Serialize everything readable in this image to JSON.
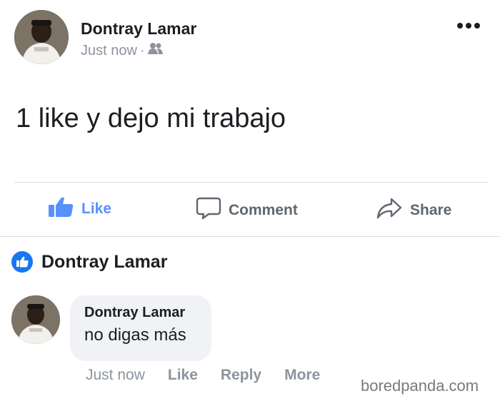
{
  "post": {
    "author": "Dontray Lamar",
    "timestamp": "Just now",
    "separator": "·",
    "audience_icon": "friends-icon",
    "text": "1 like y dejo mi trabajo",
    "more_icon": "more-dots-icon"
  },
  "actions": {
    "like_label": "Like",
    "comment_label": "Comment",
    "share_label": "Share"
  },
  "reactions": {
    "liker_name": "Dontray Lamar",
    "icon": "like-badge-icon"
  },
  "comment": {
    "author": "Dontray Lamar",
    "text": "no digas más",
    "timestamp": "Just now",
    "like_label": "Like",
    "reply_label": "Reply",
    "more_label": "More"
  },
  "watermark": "boredpanda.com",
  "colors": {
    "accent": "#5890ff",
    "badge": "#1877f2",
    "muted": "#8d949e",
    "bubble": "#f0f2f5"
  }
}
